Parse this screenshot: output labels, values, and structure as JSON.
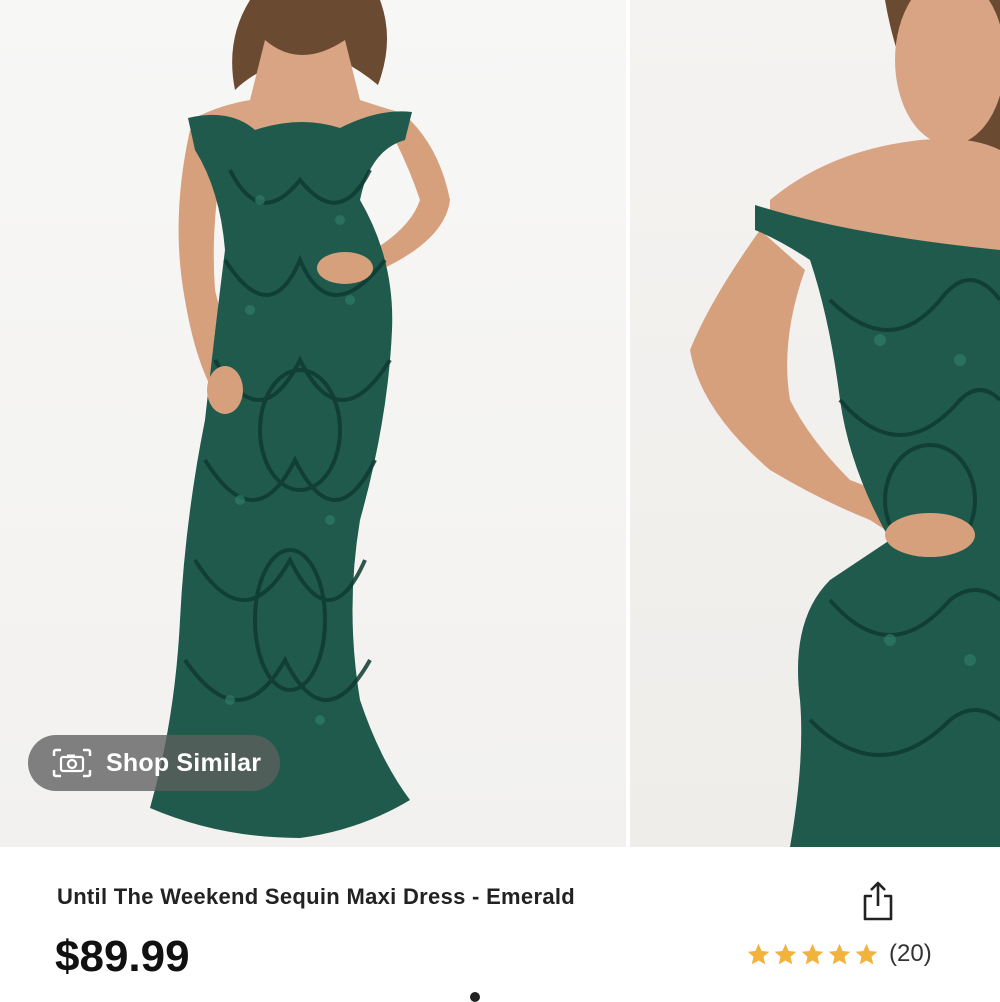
{
  "gallery": {
    "photos": [
      {
        "alt": "full-length-model-photo"
      },
      {
        "alt": "closeup-model-photo"
      }
    ],
    "shop_similar_label": "Shop Similar"
  },
  "product": {
    "title": "Until The Weekend Sequin Maxi Dress - Emerald",
    "price": "$89.99",
    "rating": 5,
    "review_count": "(20)"
  },
  "colors": {
    "dress": "#1f5a4c",
    "star": "#f2b33d",
    "text": "#222222"
  },
  "icons": {
    "camera": "camera-icon",
    "share": "share-icon",
    "star": "star-icon"
  }
}
